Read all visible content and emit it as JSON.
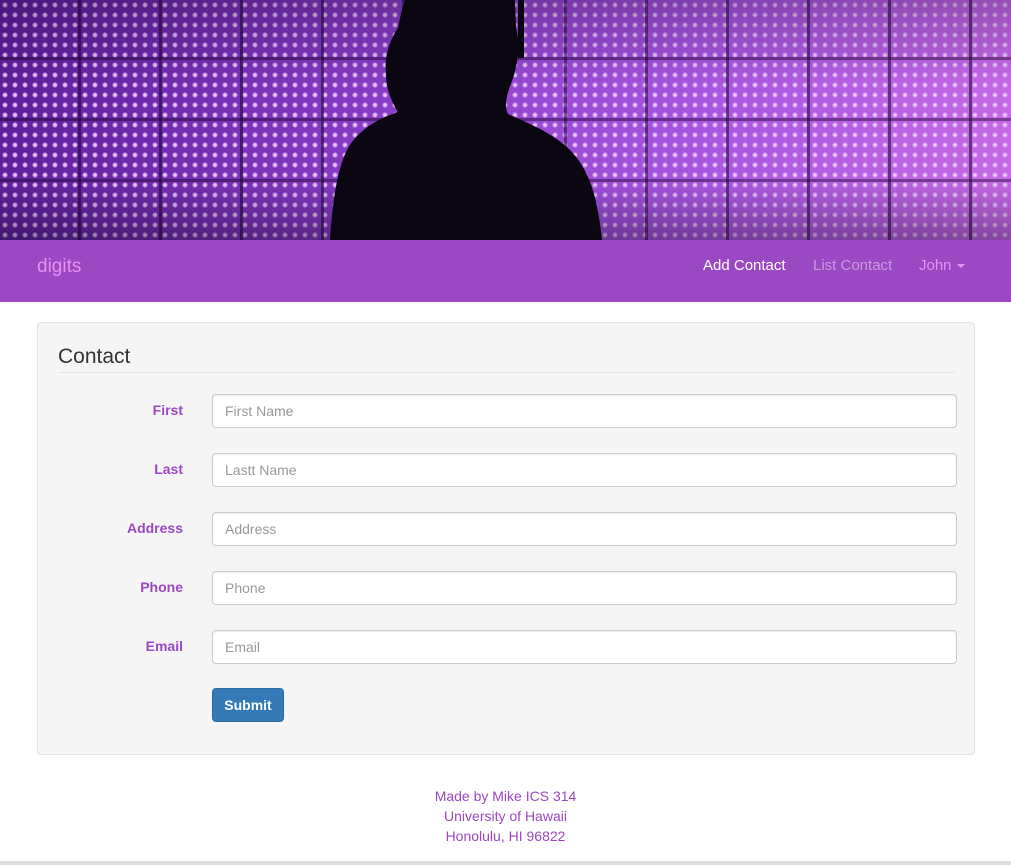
{
  "hero": {
    "image": "purple-led-wall-silhouette"
  },
  "navbar": {
    "brand": "digits",
    "links": [
      {
        "label": "Add Contact",
        "active": true
      },
      {
        "label": "List Contact",
        "active": false
      }
    ],
    "user": {
      "label": "John",
      "icon": "caret-down-icon"
    }
  },
  "form": {
    "title": "Contact",
    "fields": [
      {
        "label": "First",
        "placeholder": "First Name",
        "value": ""
      },
      {
        "label": "Last",
        "placeholder": "Lastt Name",
        "value": ""
      },
      {
        "label": "Address",
        "placeholder": "Address",
        "value": ""
      },
      {
        "label": "Phone",
        "placeholder": "Phone",
        "value": ""
      },
      {
        "label": "Email",
        "placeholder": "Email",
        "value": ""
      }
    ],
    "submit_label": "Submit"
  },
  "footer": {
    "lines": [
      "Made by Mike ICS 314",
      "University of Hawaii",
      "Honolulu, HI 96822"
    ]
  },
  "colors": {
    "brand_purple": "#9b48c3",
    "accent_pink": "#e890f5",
    "button_blue": "#337ab7"
  }
}
